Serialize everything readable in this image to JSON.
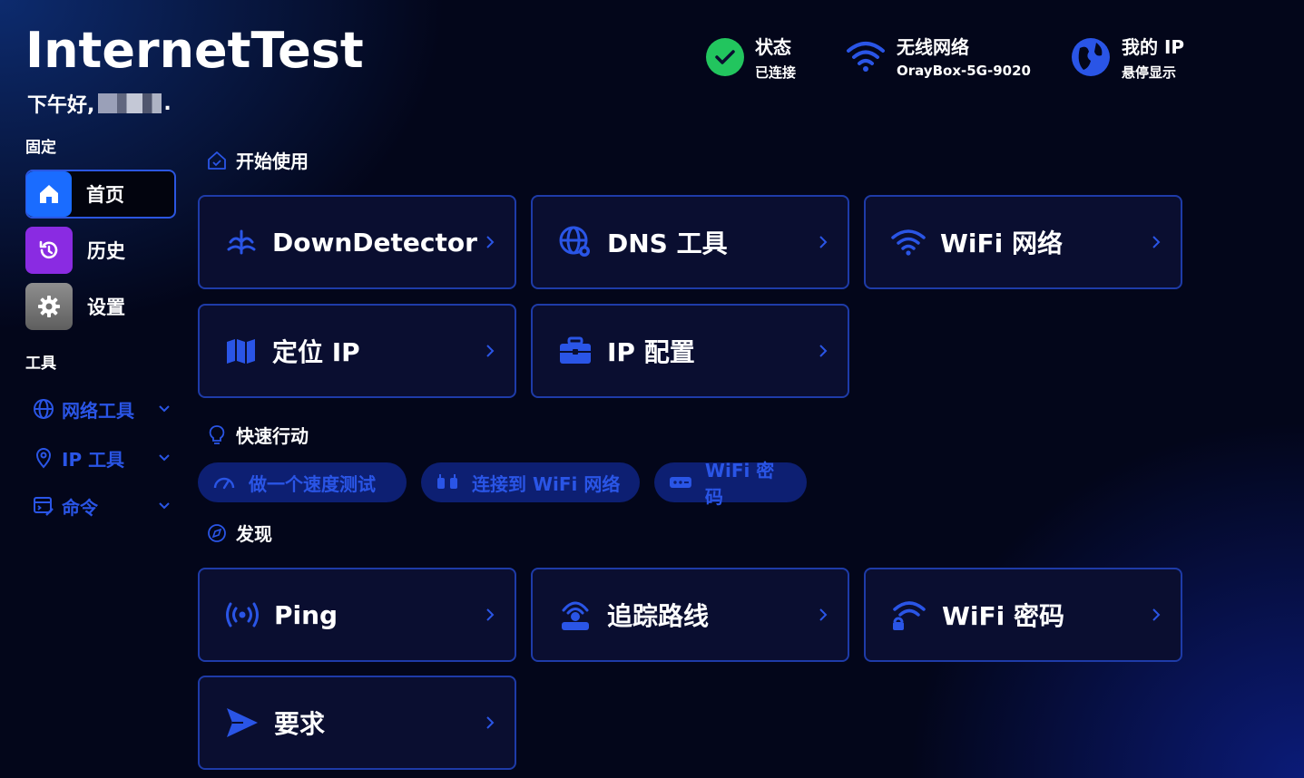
{
  "app": {
    "title": "InternetTest",
    "greeting_prefix": "下午好,",
    "greeting_suffix": "."
  },
  "status": {
    "connection": {
      "title": "状态",
      "value": "已连接"
    },
    "wifi": {
      "title": "无线网络",
      "value": "OrayBox-5G-9020"
    },
    "ip": {
      "title": "我的 IP",
      "value": "悬停显示"
    }
  },
  "sidebar": {
    "pinned_label": "固定",
    "pinned": [
      {
        "label": "首页",
        "icon": "home-icon",
        "color": "#1a6cff"
      },
      {
        "label": "历史",
        "icon": "history-icon",
        "color": "#8a2be2"
      },
      {
        "label": "设置",
        "icon": "gear-icon",
        "color": "#7a7a7a"
      }
    ],
    "tools_label": "工具",
    "tools": [
      {
        "label": "网络工具",
        "icon": "globe-icon"
      },
      {
        "label": "IP 工具",
        "icon": "location-pin-icon"
      },
      {
        "label": "命令",
        "icon": "command-icon"
      }
    ]
  },
  "sections": {
    "get_started": {
      "title": "开始使用",
      "cards": [
        {
          "label": "DownDetector",
          "icon": "downdetector-icon"
        },
        {
          "label": "DNS 工具",
          "icon": "globe-network-icon"
        },
        {
          "label": "WiFi 网络",
          "icon": "wifi-icon"
        },
        {
          "label": "定位 IP",
          "icon": "map-icon"
        },
        {
          "label": "IP 配置",
          "icon": "toolbox-icon"
        }
      ]
    },
    "quick_actions": {
      "title": "快速行动",
      "actions": [
        {
          "label": "做一个速度测试",
          "icon": "speedometer-icon"
        },
        {
          "label": "连接到 WiFi 网络",
          "icon": "plug-icon"
        },
        {
          "label": "WiFi 密码",
          "icon": "password-icon"
        }
      ]
    },
    "discover": {
      "title": "发现",
      "cards": [
        {
          "label": "Ping",
          "icon": "ping-icon"
        },
        {
          "label": "追踪路线",
          "icon": "route-icon"
        },
        {
          "label": "WiFi 密码",
          "icon": "wifi-lock-icon"
        },
        {
          "label": "要求",
          "icon": "send-icon"
        }
      ]
    }
  },
  "colors": {
    "accent": "#2a55e6",
    "card_border": "#1e3ba8",
    "card_bg": "#0a0e30",
    "success": "#22c55e"
  }
}
